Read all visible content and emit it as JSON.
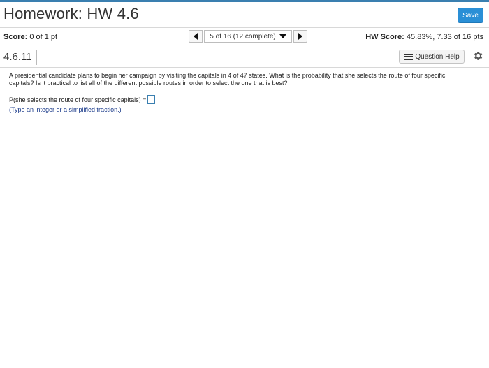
{
  "header": {
    "title": "Homework: HW 4.6",
    "save_label": "Save"
  },
  "scorebar": {
    "score_label": "Score:",
    "score_value": "0 of 1 pt",
    "question_selector": "5 of 16 (12 complete)",
    "hw_score_label": "HW Score:",
    "hw_score_value": "45.83%, 7.33 of 16 pts"
  },
  "question_bar": {
    "number": "4.6.11",
    "help_label": "Question Help"
  },
  "question": {
    "text": "A presidential candidate plans to begin her campaign by visiting the capitals in 4 of 47 states. What is the probability that she selects the route of four specific capitals? Is it practical to list all of the different possible routes in order to select the one that is best?",
    "answer_prompt": "P(she selects the route of four specific capitals) =",
    "hint": "(Type an integer or a simplified fraction.)"
  },
  "icons": {
    "prev": "triangle-left-icon",
    "next": "triangle-right-icon",
    "dropdown": "triangle-down-icon",
    "help": "list-icon",
    "settings": "gear-icon"
  },
  "colors": {
    "accent": "#2a8fd6",
    "topline": "#3a7fb0",
    "hint": "#1a3a8a"
  }
}
